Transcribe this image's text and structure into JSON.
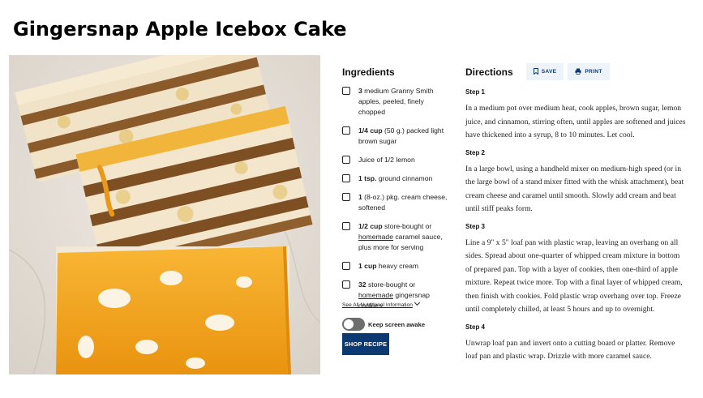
{
  "page": {
    "title": "Gingersnap Apple Icebox Cake"
  },
  "photo": {
    "subject": "Gingersnap apple icebox cake slices drizzled with caramel"
  },
  "ingredients": {
    "heading": "Ingredients",
    "items": [
      {
        "qty": "3",
        "text": " medium Granny Smith apples, peeled, finely chopped",
        "link": "",
        "after": ""
      },
      {
        "qty": "1/4 cup",
        "text": " (50 g.) packed light brown sugar",
        "link": "",
        "after": ""
      },
      {
        "qty": "",
        "text": "Juice of 1/2 lemon",
        "link": "",
        "after": ""
      },
      {
        "qty": "1 tsp.",
        "text": " ground cinnamon",
        "link": "",
        "after": ""
      },
      {
        "qty": "1",
        "text": " (8-oz.) pkg. cream cheese, softened",
        "link": "",
        "after": ""
      },
      {
        "qty": "1/2 cup",
        "text": " store-bought or ",
        "link": "homemade",
        "after": " caramel sauce, plus more for serving"
      },
      {
        "qty": "1 cup",
        "text": " heavy cream",
        "link": "",
        "after": ""
      },
      {
        "qty": "32",
        "text": " store-bought or ",
        "link": "homemade",
        "after": " gingersnap cookies"
      }
    ],
    "nutrition_link": "See All Nutritional Information",
    "keep_awake_label": "Keep screen awake",
    "shop_button": "SHOP RECIPE"
  },
  "directions": {
    "heading": "Directions",
    "save_label": "SAVE",
    "print_label": "PRINT",
    "steps": [
      {
        "label": "Step 1",
        "text": "In a medium pot over medium heat, cook apples, brown sugar, lemon juice, and cinnamon, stirring often, until apples are softened and juices have thickened into a syrup, 8 to 10 minutes. Let cool."
      },
      {
        "label": "Step 2",
        "text": "In a large bowl, using a handheld mixer on medium-high speed (or in the large bowl of a stand mixer fitted with the whisk attachment), beat cream cheese and caramel until smooth. Slowly add cream and beat until stiff peaks form."
      },
      {
        "label": "Step 3",
        "text": "Line a 9\" x 5\" loaf pan with plastic wrap, leaving an overhang on all sides. Spread about one-quarter of whipped cream mixture in bottom of prepared pan. Top with a layer of cookies, then one-third of apple mixture. Repeat twice more. Top with a final layer of whipped cream, then finish with cookies. Fold plastic wrap overhang over top. Freeze until completely chilled, at least 5 hours and up to overnight."
      },
      {
        "label": "Step 4",
        "text": "Unwrap loaf pan and invert onto a cutting board or platter. Remove loaf pan and plastic wrap. Drizzle with more caramel sauce."
      }
    ]
  },
  "colors": {
    "button_primary": "#0b3a73",
    "button_secondary_bg": "#eef3fa",
    "toggle_off": "#6e6e6e",
    "caramel": "#f0a020"
  },
  "icons": {
    "save": "bookmark-icon",
    "print": "printer-icon",
    "nutrition": "chevron-down-icon"
  }
}
